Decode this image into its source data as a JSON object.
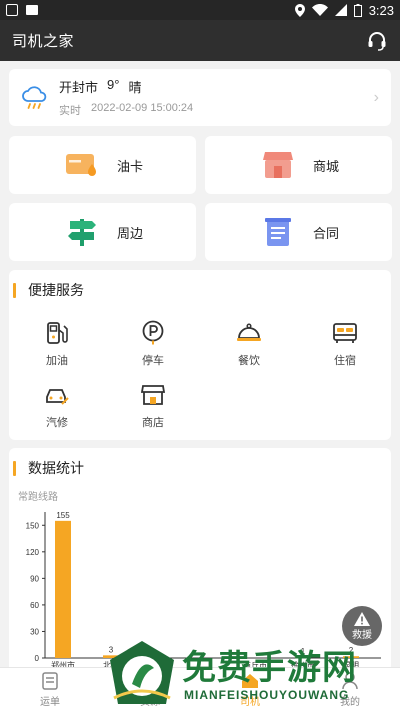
{
  "status_bar": {
    "time": "3:23"
  },
  "app_bar": {
    "title": "司机之家"
  },
  "weather": {
    "city": "开封市",
    "temp": "9°",
    "condition": "晴",
    "label": "实时",
    "datetime": "2022-02-09 15:00:24"
  },
  "tiles": [
    {
      "label": "油卡"
    },
    {
      "label": "商城"
    },
    {
      "label": "周边"
    },
    {
      "label": "合同"
    }
  ],
  "services": {
    "title": "便捷服务",
    "items": [
      {
        "label": "加油",
        "icon": "fuel-pump-icon"
      },
      {
        "label": "停车",
        "icon": "parking-icon"
      },
      {
        "label": "餐饮",
        "icon": "food-cloche-icon"
      },
      {
        "label": "住宿",
        "icon": "bed-icon"
      },
      {
        "label": "汽修",
        "icon": "car-repair-icon"
      },
      {
        "label": "商店",
        "icon": "store-icon"
      }
    ]
  },
  "stats": {
    "title": "数据统计",
    "subtitle": "常跑线路"
  },
  "chart_data": {
    "type": "bar",
    "categories": [
      "郑州市",
      "北京",
      "",
      "",
      "商丘市",
      "徐州市",
      "昆明"
    ],
    "values": [
      155,
      3,
      0,
      0,
      0,
      1,
      2
    ],
    "ylim": [
      0,
      165
    ],
    "yticks": [
      0,
      30,
      60,
      90,
      120,
      150
    ],
    "color": "#f5a623"
  },
  "rescue_button": {
    "label": "救援"
  },
  "tabbar": {
    "items": [
      {
        "label": "运单"
      },
      {
        "label": "货源"
      },
      {
        "label": "司机"
      },
      {
        "label": "我的"
      }
    ]
  },
  "watermark": {
    "title": "免费手游网",
    "subtitle": "MIANFEISHOUYOUWANG"
  },
  "colors": {
    "accent": "#f5a623",
    "appbar": "#2f2f2f"
  }
}
